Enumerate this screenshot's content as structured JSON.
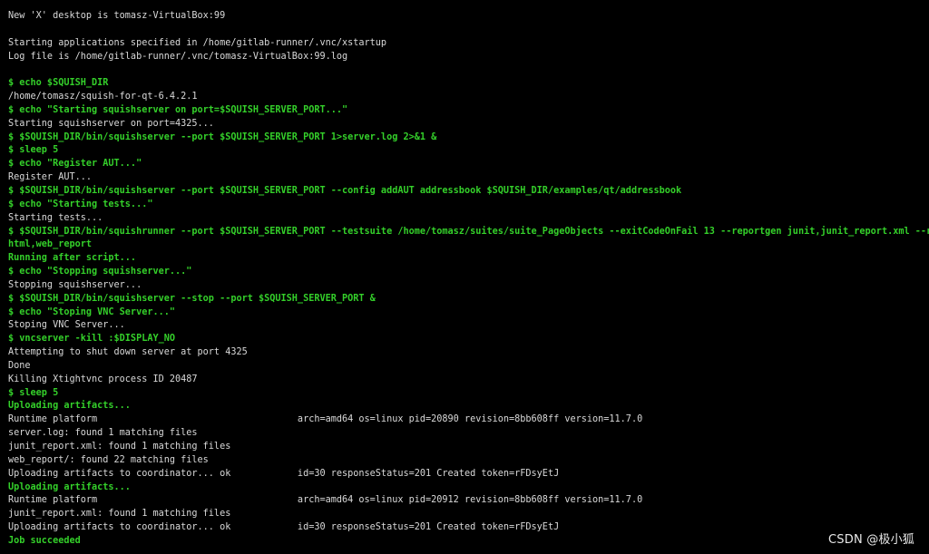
{
  "terminal": {
    "colors": {
      "background": "#000000",
      "output": "#d9d9d9",
      "command": "#34d02a"
    },
    "lines": [
      {
        "type": "out",
        "text": "New 'X' desktop is tomasz-VirtualBox:99"
      },
      {
        "type": "blank",
        "text": ""
      },
      {
        "type": "out",
        "text": "Starting applications specified in /home/gitlab-runner/.vnc/xstartup"
      },
      {
        "type": "out",
        "text": "Log file is /home/gitlab-runner/.vnc/tomasz-VirtualBox:99.log"
      },
      {
        "type": "blank",
        "text": ""
      },
      {
        "type": "cmd",
        "text": "$ echo $SQUISH_DIR"
      },
      {
        "type": "out",
        "text": "/home/tomasz/squish-for-qt-6.4.2.1"
      },
      {
        "type": "cmd",
        "text": "$ echo \"Starting squishserver on port=$SQUISH_SERVER_PORT...\""
      },
      {
        "type": "out",
        "text": "Starting squishserver on port=4325..."
      },
      {
        "type": "cmd",
        "text": "$ $SQUISH_DIR/bin/squishserver --port $SQUISH_SERVER_PORT 1>server.log 2>&1 &"
      },
      {
        "type": "cmd",
        "text": "$ sleep 5"
      },
      {
        "type": "cmd",
        "text": "$ echo \"Register AUT...\""
      },
      {
        "type": "out",
        "text": "Register AUT..."
      },
      {
        "type": "cmd",
        "text": "$ $SQUISH_DIR/bin/squishserver --port $SQUISH_SERVER_PORT --config addAUT addressbook $SQUISH_DIR/examples/qt/addressbook"
      },
      {
        "type": "cmd",
        "text": "$ echo \"Starting tests...\""
      },
      {
        "type": "out",
        "text": "Starting tests..."
      },
      {
        "type": "cmd",
        "text": "$ $SQUISH_DIR/bin/squishrunner --port $SQUISH_SERVER_PORT --testsuite /home/tomasz/suites/suite_PageObjects --exitCodeOnFail 13 --reportgen junit,junit_report.xml --reportgen"
      },
      {
        "type": "cmd",
        "text": "html,web_report"
      },
      {
        "type": "info",
        "text": "Running after script..."
      },
      {
        "type": "cmd",
        "text": "$ echo \"Stopping squishserver...\""
      },
      {
        "type": "out",
        "text": "Stopping squishserver..."
      },
      {
        "type": "cmd",
        "text": "$ $SQUISH_DIR/bin/squishserver --stop --port $SQUISH_SERVER_PORT &"
      },
      {
        "type": "cmd",
        "text": "$ echo \"Stoping VNC Server...\""
      },
      {
        "type": "out",
        "text": "Stoping VNC Server..."
      },
      {
        "type": "cmd",
        "text": "$ vncserver -kill :$DISPLAY_NO"
      },
      {
        "type": "out",
        "text": "Attempting to shut down server at port 4325"
      },
      {
        "type": "out",
        "text": "Done"
      },
      {
        "type": "out",
        "text": "Killing Xtightvnc process ID 20487"
      },
      {
        "type": "cmd",
        "text": "$ sleep 5"
      },
      {
        "type": "info",
        "text": "Uploading artifacts..."
      },
      {
        "type": "out",
        "text": "Runtime platform                                    arch=amd64 os=linux pid=20890 revision=8bb608ff version=11.7.0"
      },
      {
        "type": "out",
        "text": "server.log: found 1 matching files"
      },
      {
        "type": "out",
        "text": "junit_report.xml: found 1 matching files"
      },
      {
        "type": "out",
        "text": "web_report/: found 22 matching files"
      },
      {
        "type": "out",
        "text": "Uploading artifacts to coordinator... ok            id=30 responseStatus=201 Created token=rFDsyEtJ"
      },
      {
        "type": "info",
        "text": "Uploading artifacts..."
      },
      {
        "type": "out",
        "text": "Runtime platform                                    arch=amd64 os=linux pid=20912 revision=8bb608ff version=11.7.0"
      },
      {
        "type": "out",
        "text": "junit_report.xml: found 1 matching files"
      },
      {
        "type": "out",
        "text": "Uploading artifacts to coordinator... ok            id=30 responseStatus=201 Created token=rFDsyEtJ"
      },
      {
        "type": "info",
        "text": "Job succeeded"
      }
    ]
  },
  "watermark": {
    "text": "CSDN @极小狐"
  }
}
